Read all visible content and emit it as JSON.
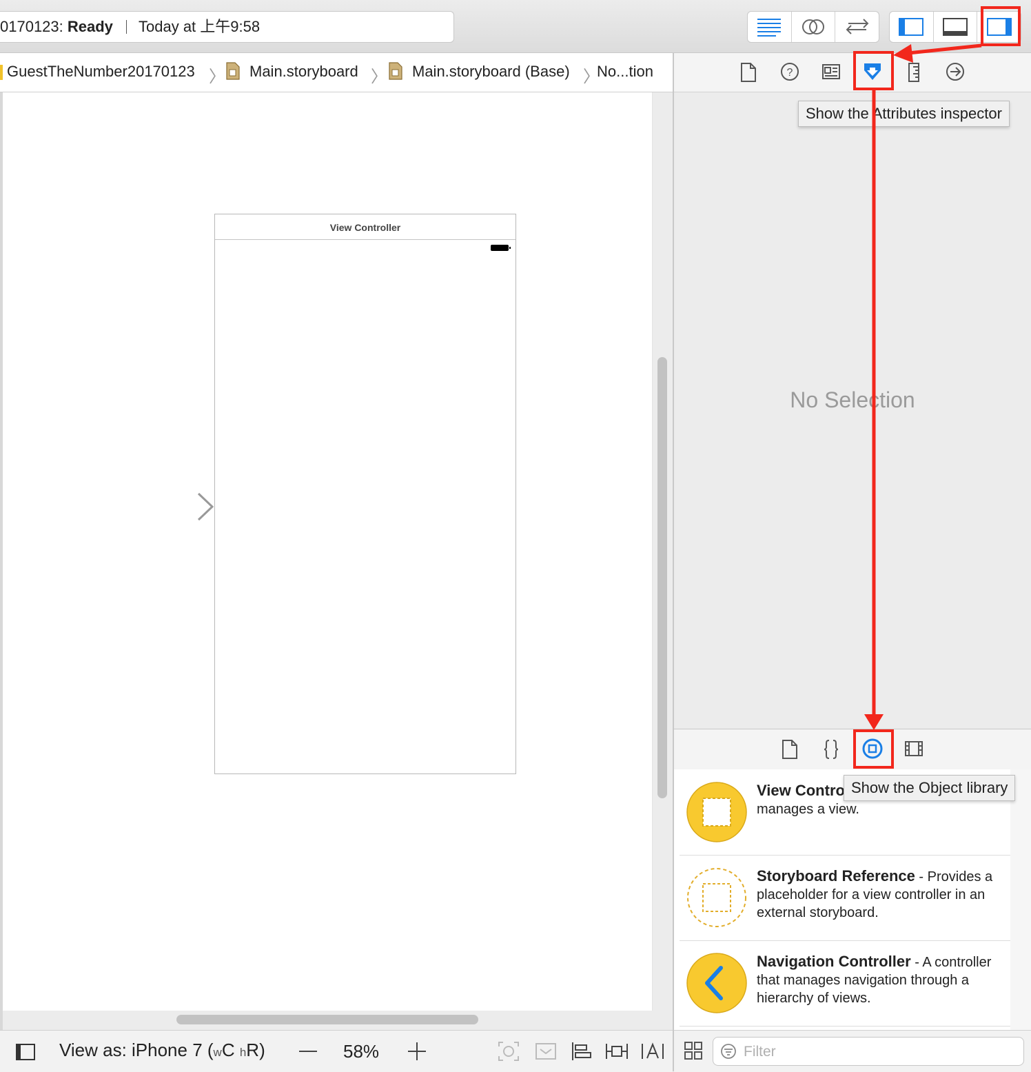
{
  "toolbar": {
    "project_status_prefix": "0170123: ",
    "project_status": "Ready",
    "activity_time": "Today at 上午9:58"
  },
  "jumpbar": {
    "crumbs": [
      "GuestTheNumber20170123",
      "Main.storyboard",
      "Main.storyboard (Base)",
      "No...tion"
    ]
  },
  "canvas": {
    "scene_title": "View Controller"
  },
  "bottombar": {
    "view_as_label": "View as: iPhone 7 (",
    "size_w": "w",
    "size_c": "C ",
    "size_h": "h",
    "size_r": "R)",
    "zoom_level": "58%"
  },
  "inspector": {
    "empty_state": "No Selection",
    "tooltip": "Show the Attributes inspector"
  },
  "library": {
    "tooltip": "Show the Object library",
    "items": [
      {
        "title": "View Controller",
        "description": " - A controller that manages a view."
      },
      {
        "title": "Storyboard Reference",
        "description": " - Provides a placeholder for a view controller in an external storyboard."
      },
      {
        "title": "Navigation Controller",
        "description": " - A controller that manages navigation through a hierarchy of views."
      }
    ],
    "filter_placeholder": "Filter"
  },
  "colors": {
    "accent": "#1a7fe6",
    "annotation_red": "#f2271c",
    "library_yellow": "#f8c92f"
  }
}
